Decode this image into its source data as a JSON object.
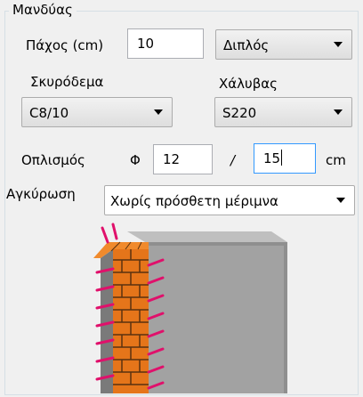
{
  "group": {
    "title": "Μανδύας"
  },
  "thickness": {
    "label": "Πάχος (cm)",
    "value": "10"
  },
  "jacket_type": {
    "selected": "Διπλός"
  },
  "concrete": {
    "label": "Σκυρόδεμα",
    "selected": "C8/10"
  },
  "steel": {
    "label": "Χάλυβας",
    "selected": "S220"
  },
  "reinforcement": {
    "label": "Οπλισμός",
    "phi_symbol": "Φ",
    "diameter": "12",
    "separator": "/",
    "spacing": "15",
    "unit": "cm"
  },
  "anchorage": {
    "label": "Αγκύρωση",
    "selected": "Χωρίς πρόσθετη μέριμνα"
  },
  "colors": {
    "brick": "#e5751a",
    "mortar": "#5a3210",
    "concrete": "#9b9b9b",
    "anchor": "#e0106b",
    "focus_border": "#3399ff"
  }
}
